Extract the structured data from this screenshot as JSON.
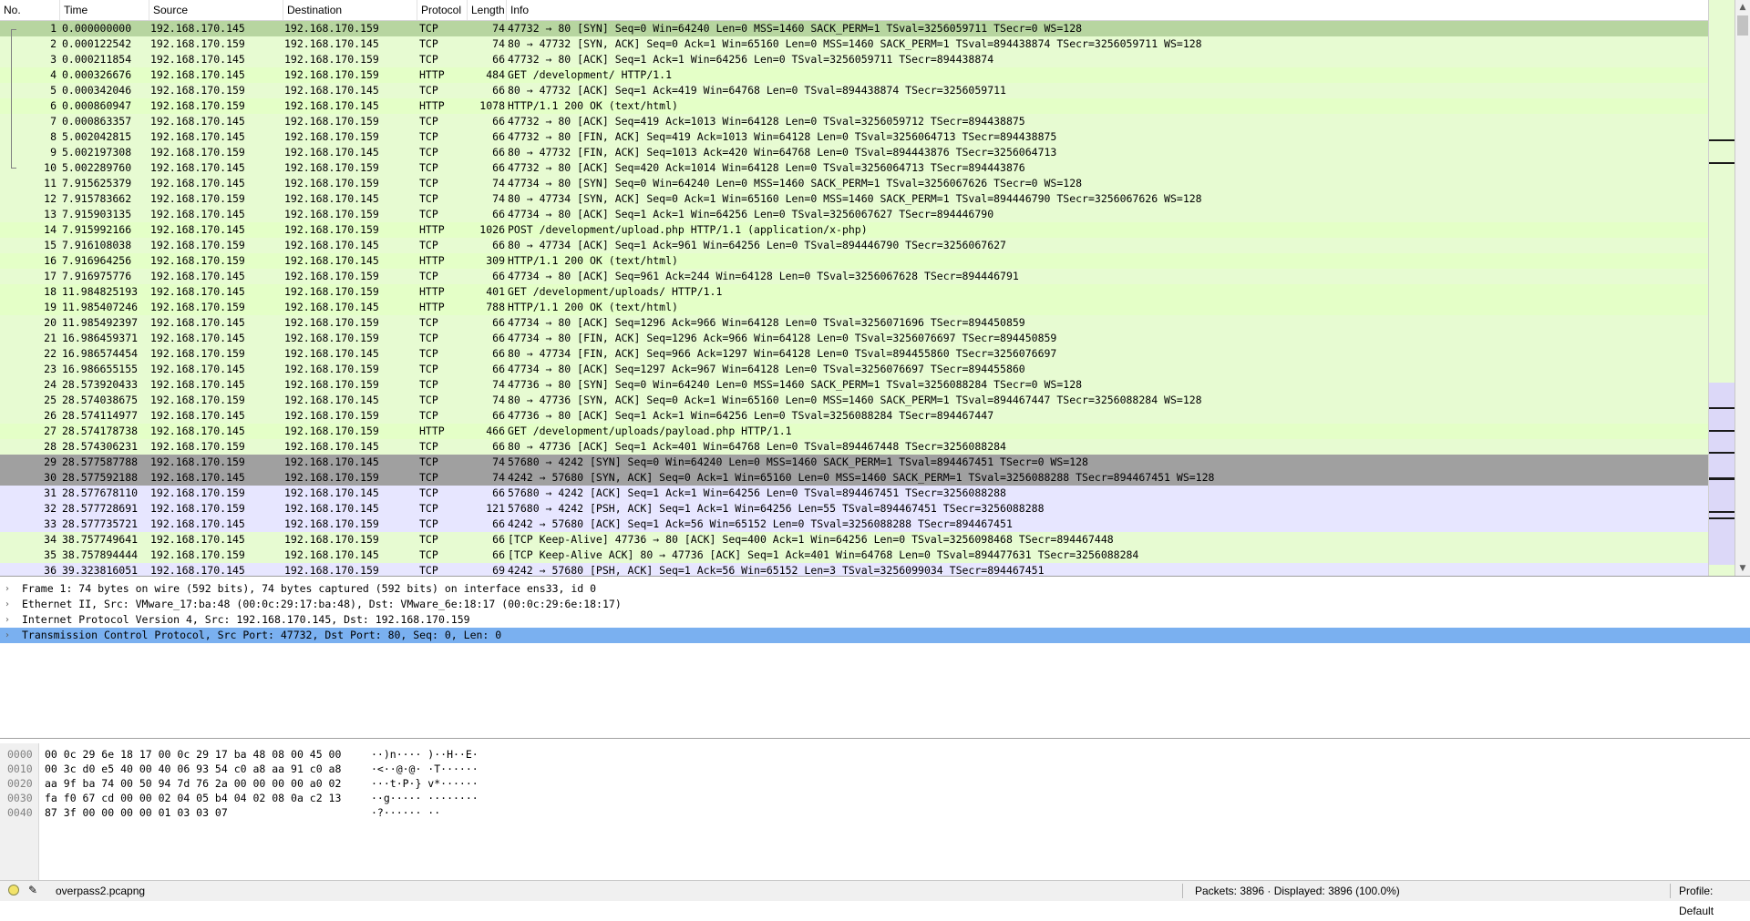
{
  "packet_list": {
    "columns": [
      "No.",
      "Time",
      "Source",
      "Destination",
      "Protocol",
      "Length",
      "Info"
    ],
    "rows": [
      {
        "no": "1",
        "time": "0.000000000",
        "src": "192.168.170.145",
        "dst": "192.168.170.159",
        "proto": "TCP",
        "len": "74",
        "info": "47732 → 80 [SYN] Seq=0 Win=64240 Len=0 MSS=1460 SACK_PERM=1 TSval=3256059711 TSecr=0 WS=128",
        "style": "sel"
      },
      {
        "no": "2",
        "time": "0.000122542",
        "src": "192.168.170.159",
        "dst": "192.168.170.145",
        "proto": "TCP",
        "len": "74",
        "info": "80 → 47732 [SYN, ACK] Seq=0 Ack=1 Win=65160 Len=0 MSS=1460 SACK_PERM=1 TSval=894438874 TSecr=3256059711 WS=128",
        "style": "tcp"
      },
      {
        "no": "3",
        "time": "0.000211854",
        "src": "192.168.170.145",
        "dst": "192.168.170.159",
        "proto": "TCP",
        "len": "66",
        "info": "47732 → 80 [ACK] Seq=1 Ack=1 Win=64256 Len=0 TSval=3256059711 TSecr=894438874",
        "style": "tcp"
      },
      {
        "no": "4",
        "time": "0.000326676",
        "src": "192.168.170.145",
        "dst": "192.168.170.159",
        "proto": "HTTP",
        "len": "484",
        "info": "GET /development/ HTTP/1.1",
        "style": "http"
      },
      {
        "no": "5",
        "time": "0.000342046",
        "src": "192.168.170.159",
        "dst": "192.168.170.145",
        "proto": "TCP",
        "len": "66",
        "info": "80 → 47732 [ACK] Seq=1 Ack=419 Win=64768 Len=0 TSval=894438874 TSecr=3256059711",
        "style": "tcp"
      },
      {
        "no": "6",
        "time": "0.000860947",
        "src": "192.168.170.159",
        "dst": "192.168.170.145",
        "proto": "HTTP",
        "len": "1078",
        "info": "HTTP/1.1 200 OK  (text/html)",
        "style": "http"
      },
      {
        "no": "7",
        "time": "0.000863357",
        "src": "192.168.170.145",
        "dst": "192.168.170.159",
        "proto": "TCP",
        "len": "66",
        "info": "47732 → 80 [ACK] Seq=419 Ack=1013 Win=64128 Len=0 TSval=3256059712 TSecr=894438875",
        "style": "tcp"
      },
      {
        "no": "8",
        "time": "5.002042815",
        "src": "192.168.170.145",
        "dst": "192.168.170.159",
        "proto": "TCP",
        "len": "66",
        "info": "47732 → 80 [FIN, ACK] Seq=419 Ack=1013 Win=64128 Len=0 TSval=3256064713 TSecr=894438875",
        "style": "tcp"
      },
      {
        "no": "9",
        "time": "5.002197308",
        "src": "192.168.170.159",
        "dst": "192.168.170.145",
        "proto": "TCP",
        "len": "66",
        "info": "80 → 47732 [FIN, ACK] Seq=1013 Ack=420 Win=64768 Len=0 TSval=894443876 TSecr=3256064713",
        "style": "tcp"
      },
      {
        "no": "10",
        "time": "5.002289760",
        "src": "192.168.170.145",
        "dst": "192.168.170.159",
        "proto": "TCP",
        "len": "66",
        "info": "47732 → 80 [ACK] Seq=420 Ack=1014 Win=64128 Len=0 TSval=3256064713 TSecr=894443876",
        "style": "tcp"
      },
      {
        "no": "11",
        "time": "7.915625379",
        "src": "192.168.170.145",
        "dst": "192.168.170.159",
        "proto": "TCP",
        "len": "74",
        "info": "47734 → 80 [SYN] Seq=0 Win=64240 Len=0 MSS=1460 SACK_PERM=1 TSval=3256067626 TSecr=0 WS=128",
        "style": "tcp"
      },
      {
        "no": "12",
        "time": "7.915783662",
        "src": "192.168.170.159",
        "dst": "192.168.170.145",
        "proto": "TCP",
        "len": "74",
        "info": "80 → 47734 [SYN, ACK] Seq=0 Ack=1 Win=65160 Len=0 MSS=1460 SACK_PERM=1 TSval=894446790 TSecr=3256067626 WS=128",
        "style": "tcp"
      },
      {
        "no": "13",
        "time": "7.915903135",
        "src": "192.168.170.145",
        "dst": "192.168.170.159",
        "proto": "TCP",
        "len": "66",
        "info": "47734 → 80 [ACK] Seq=1 Ack=1 Win=64256 Len=0 TSval=3256067627 TSecr=894446790",
        "style": "tcp"
      },
      {
        "no": "14",
        "time": "7.915992166",
        "src": "192.168.170.145",
        "dst": "192.168.170.159",
        "proto": "HTTP",
        "len": "1026",
        "info": "POST /development/upload.php HTTP/1.1  (application/x-php)",
        "style": "http"
      },
      {
        "no": "15",
        "time": "7.916108038",
        "src": "192.168.170.159",
        "dst": "192.168.170.145",
        "proto": "TCP",
        "len": "66",
        "info": "80 → 47734 [ACK] Seq=1 Ack=961 Win=64256 Len=0 TSval=894446790 TSecr=3256067627",
        "style": "tcp"
      },
      {
        "no": "16",
        "time": "7.916964256",
        "src": "192.168.170.159",
        "dst": "192.168.170.145",
        "proto": "HTTP",
        "len": "309",
        "info": "HTTP/1.1 200 OK  (text/html)",
        "style": "http"
      },
      {
        "no": "17",
        "time": "7.916975776",
        "src": "192.168.170.145",
        "dst": "192.168.170.159",
        "proto": "TCP",
        "len": "66",
        "info": "47734 → 80 [ACK] Seq=961 Ack=244 Win=64128 Len=0 TSval=3256067628 TSecr=894446791",
        "style": "tcp"
      },
      {
        "no": "18",
        "time": "11.984825193",
        "src": "192.168.170.145",
        "dst": "192.168.170.159",
        "proto": "HTTP",
        "len": "401",
        "info": "GET /development/uploads/ HTTP/1.1",
        "style": "http"
      },
      {
        "no": "19",
        "time": "11.985407246",
        "src": "192.168.170.159",
        "dst": "192.168.170.145",
        "proto": "HTTP",
        "len": "788",
        "info": "HTTP/1.1 200 OK  (text/html)",
        "style": "http"
      },
      {
        "no": "20",
        "time": "11.985492397",
        "src": "192.168.170.145",
        "dst": "192.168.170.159",
        "proto": "TCP",
        "len": "66",
        "info": "47734 → 80 [ACK] Seq=1296 Ack=966 Win=64128 Len=0 TSval=3256071696 TSecr=894450859",
        "style": "tcp"
      },
      {
        "no": "21",
        "time": "16.986459371",
        "src": "192.168.170.145",
        "dst": "192.168.170.159",
        "proto": "TCP",
        "len": "66",
        "info": "47734 → 80 [FIN, ACK] Seq=1296 Ack=966 Win=64128 Len=0 TSval=3256076697 TSecr=894450859",
        "style": "tcp"
      },
      {
        "no": "22",
        "time": "16.986574454",
        "src": "192.168.170.159",
        "dst": "192.168.170.145",
        "proto": "TCP",
        "len": "66",
        "info": "80 → 47734 [FIN, ACK] Seq=966 Ack=1297 Win=64128 Len=0 TSval=894455860 TSecr=3256076697",
        "style": "tcp"
      },
      {
        "no": "23",
        "time": "16.986655155",
        "src": "192.168.170.145",
        "dst": "192.168.170.159",
        "proto": "TCP",
        "len": "66",
        "info": "47734 → 80 [ACK] Seq=1297 Ack=967 Win=64128 Len=0 TSval=3256076697 TSecr=894455860",
        "style": "tcp"
      },
      {
        "no": "24",
        "time": "28.573920433",
        "src": "192.168.170.145",
        "dst": "192.168.170.159",
        "proto": "TCP",
        "len": "74",
        "info": "47736 → 80 [SYN] Seq=0 Win=64240 Len=0 MSS=1460 SACK_PERM=1 TSval=3256088284 TSecr=0 WS=128",
        "style": "tcp"
      },
      {
        "no": "25",
        "time": "28.574038675",
        "src": "192.168.170.159",
        "dst": "192.168.170.145",
        "proto": "TCP",
        "len": "74",
        "info": "80 → 47736 [SYN, ACK] Seq=0 Ack=1 Win=65160 Len=0 MSS=1460 SACK_PERM=1 TSval=894467447 TSecr=3256088284 WS=128",
        "style": "tcp"
      },
      {
        "no": "26",
        "time": "28.574114977",
        "src": "192.168.170.145",
        "dst": "192.168.170.159",
        "proto": "TCP",
        "len": "66",
        "info": "47736 → 80 [ACK] Seq=1 Ack=1 Win=64256 Len=0 TSval=3256088284 TSecr=894467447",
        "style": "tcp"
      },
      {
        "no": "27",
        "time": "28.574178738",
        "src": "192.168.170.145",
        "dst": "192.168.170.159",
        "proto": "HTTP",
        "len": "466",
        "info": "GET /development/uploads/payload.php HTTP/1.1",
        "style": "http"
      },
      {
        "no": "28",
        "time": "28.574306231",
        "src": "192.168.170.159",
        "dst": "192.168.170.145",
        "proto": "TCP",
        "len": "66",
        "info": "80 → 47736 [ACK] Seq=1 Ack=401 Win=64768 Len=0 TSval=894467448 TSecr=3256088284",
        "style": "tcp"
      },
      {
        "no": "29",
        "time": "28.577587788",
        "src": "192.168.170.159",
        "dst": "192.168.170.145",
        "proto": "TCP",
        "len": "74",
        "info": "57680 → 4242 [SYN] Seq=0 Win=64240 Len=0 MSS=1460 SACK_PERM=1 TSval=894467451 TSecr=0 WS=128",
        "style": "dark"
      },
      {
        "no": "30",
        "time": "28.577592188",
        "src": "192.168.170.145",
        "dst": "192.168.170.159",
        "proto": "TCP",
        "len": "74",
        "info": "4242 → 57680 [SYN, ACK] Seq=0 Ack=1 Win=65160 Len=0 MSS=1460 SACK_PERM=1 TSval=3256088288 TSecr=894467451 WS=128",
        "style": "dark"
      },
      {
        "no": "31",
        "time": "28.577678110",
        "src": "192.168.170.159",
        "dst": "192.168.170.145",
        "proto": "TCP",
        "len": "66",
        "info": "57680 → 4242 [ACK] Seq=1 Ack=1 Win=64256 Len=0 TSval=894467451 TSecr=3256088288",
        "style": "alt"
      },
      {
        "no": "32",
        "time": "28.577728691",
        "src": "192.168.170.159",
        "dst": "192.168.170.145",
        "proto": "TCP",
        "len": "121",
        "info": "57680 → 4242 [PSH, ACK] Seq=1 Ack=1 Win=64256 Len=55 TSval=894467451 TSecr=3256088288",
        "style": "alt"
      },
      {
        "no": "33",
        "time": "28.577735721",
        "src": "192.168.170.145",
        "dst": "192.168.170.159",
        "proto": "TCP",
        "len": "66",
        "info": "4242 → 57680 [ACK] Seq=1 Ack=56 Win=65152 Len=0 TSval=3256088288 TSecr=894467451",
        "style": "alt"
      },
      {
        "no": "34",
        "time": "38.757749641",
        "src": "192.168.170.145",
        "dst": "192.168.170.159",
        "proto": "TCP",
        "len": "66",
        "info": "[TCP Keep-Alive] 47736 → 80 [ACK] Seq=400 Ack=1 Win=64256 Len=0 TSval=3256098468 TSecr=894467448",
        "style": "tcp"
      },
      {
        "no": "35",
        "time": "38.757894444",
        "src": "192.168.170.159",
        "dst": "192.168.170.145",
        "proto": "TCP",
        "len": "66",
        "info": "[TCP Keep-Alive ACK] 80 → 47736 [ACK] Seq=1 Ack=401 Win=64768 Len=0 TSval=894477631 TSecr=3256088284",
        "style": "tcp"
      },
      {
        "no": "36",
        "time": "39.323816051",
        "src": "192.168.170.145",
        "dst": "192.168.170.159",
        "proto": "TCP",
        "len": "69",
        "info": "4242 → 57680 [PSH, ACK] Seq=1 Ack=56 Win=65152 Len=3 TSval=3256099034 TSecr=894467451",
        "style": "alt"
      }
    ]
  },
  "details": {
    "rows": [
      {
        "text": "Frame 1: 74 bytes on wire (592 bits), 74 bytes captured (592 bits) on interface ens33, id 0",
        "selected": false
      },
      {
        "text": "Ethernet II, Src: VMware_17:ba:48 (00:0c:29:17:ba:48), Dst: VMware_6e:18:17 (00:0c:29:6e:18:17)",
        "selected": false
      },
      {
        "text": "Internet Protocol Version 4, Src: 192.168.170.145, Dst: 192.168.170.159",
        "selected": false
      },
      {
        "text": "Transmission Control Protocol, Src Port: 47732, Dst Port: 80, Seq: 0, Len: 0",
        "selected": true
      }
    ],
    "expander_glyph": "›"
  },
  "bytes": {
    "rows": [
      {
        "offset": "0000",
        "hex": "00 0c 29 6e 18 17 00 0c  29 17 ba 48 08 00 45 00",
        "ascii": "··)n····  )··H··E·"
      },
      {
        "offset": "0010",
        "hex": "00 3c d0 e5 40 00 40 06  93 54 c0 a8 aa 91 c0 a8",
        "ascii": "·<··@·@·  ·T······"
      },
      {
        "offset": "0020",
        "hex": "aa 9f ba 74 00 50 94 7d  76 2a 00 00 00 00 a0 02",
        "ascii": "···t·P·}  v*······"
      },
      {
        "offset": "0030",
        "hex": "fa f0 67 cd 00 00 02 04  05 b4 04 02 08 0a c2 13",
        "ascii": "··g·····  ········"
      },
      {
        "offset": "0040",
        "hex": "87 3f 00 00 00 00 01 03  03 07",
        "ascii": "·?······  ··"
      }
    ]
  },
  "status": {
    "file": "overpass2.pcapng",
    "packets": "Packets: 3896 · Displayed: 3896 (100.0%)",
    "profile": "Profile: Default",
    "edit_icon_glyph": "✎"
  },
  "colors": {
    "tcp_row": "#e7fbd2",
    "selected_row": "#b7d5a0",
    "dark_row": "#a0a0a0",
    "alt_row": "#e7e6ff",
    "detail_selected": "#7ab0f0",
    "status_led": "#f2e36a"
  }
}
